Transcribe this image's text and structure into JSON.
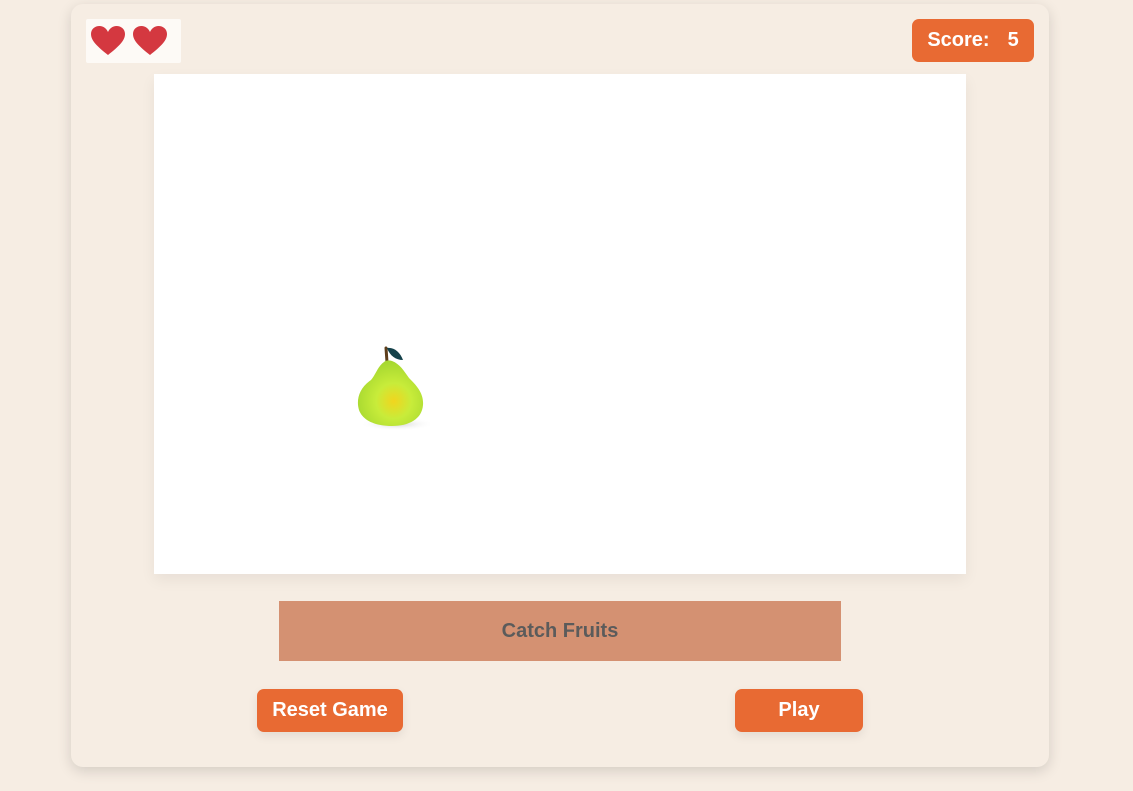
{
  "hud": {
    "lives": [
      {
        "icon": "heart-icon",
        "color": "#d43840"
      },
      {
        "icon": "heart-icon",
        "color": "#d43840"
      }
    ],
    "score_label": "Score:",
    "score_value": "5"
  },
  "play_area": {
    "falling_item": "pear-icon"
  },
  "title": "Catch Fruits",
  "buttons": {
    "reset_label": "Reset Game",
    "play_label": "Play"
  },
  "colors": {
    "accent": "#e86a33",
    "title_bar": "#d49172",
    "background": "#f6ede3",
    "heart": "#d43840"
  }
}
